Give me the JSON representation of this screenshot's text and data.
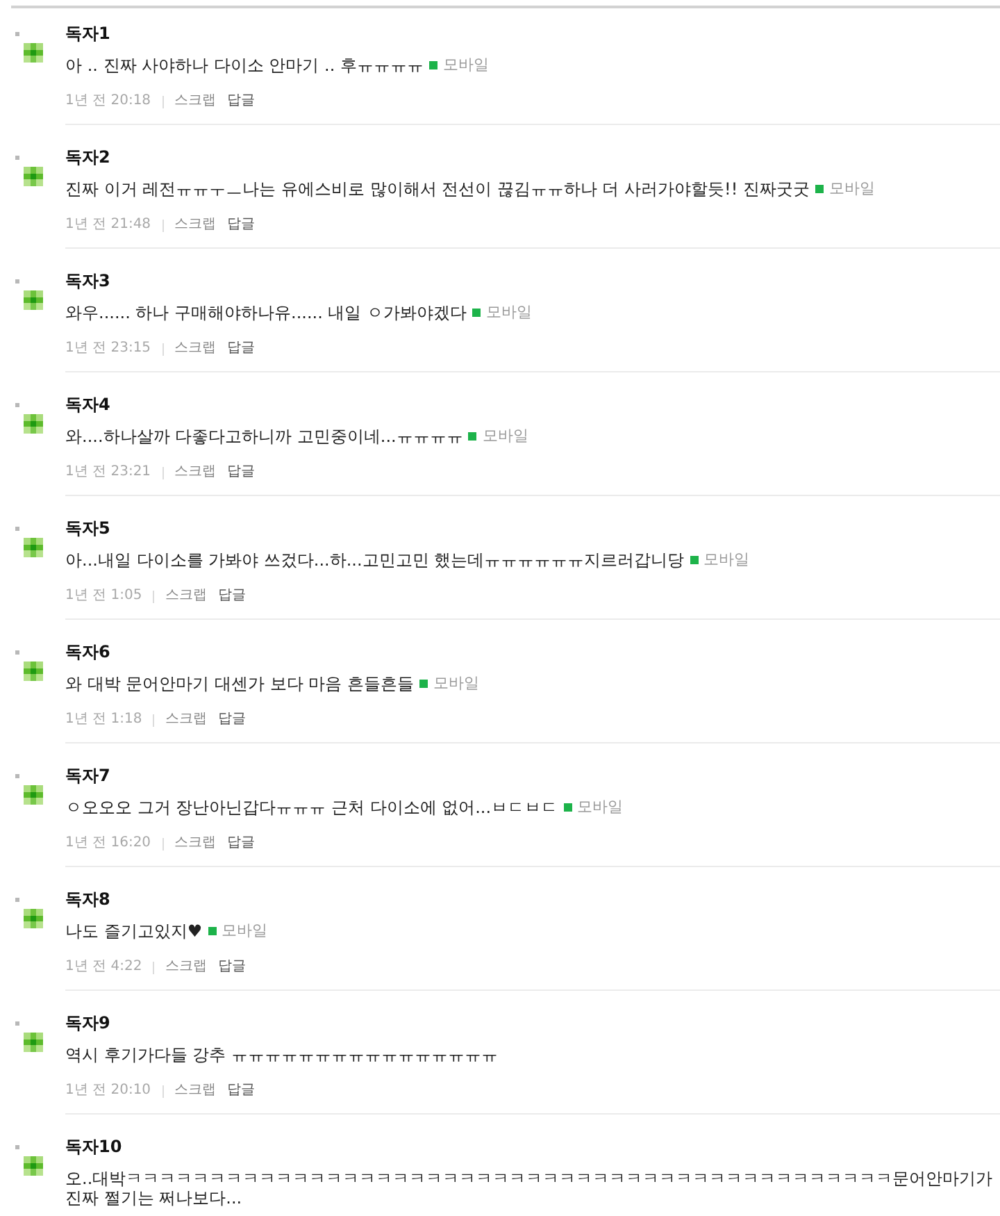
{
  "comments": [
    {
      "author": "독자1",
      "text": "아 .. 진짜 사야하나 다이소 안마기 .. 후ㅠㅠㅠㅠ",
      "mobile": "모바일",
      "time": "1년 전 20:18",
      "scrap": "스크랩",
      "reply": "답글"
    },
    {
      "author": "독자2",
      "text": "진짜 이거 레전ㅠㅠㅜㅡ나는 유에스비로 많이해서 전선이 끊김ㅠㅠ하나 더 사러가야할듯!! 진짜굿굿",
      "mobile": "모바일",
      "time": "1년 전 21:48",
      "scrap": "스크랩",
      "reply": "답글"
    },
    {
      "author": "독자3",
      "text": "와우...... 하나 구매해야하나유...... 내일 ㅇ가봐야겠다",
      "mobile": "모바일",
      "time": "1년 전 23:15",
      "scrap": "스크랩",
      "reply": "답글"
    },
    {
      "author": "독자4",
      "text": "와....하나살까 다좋다고하니까 고민중이네...ㅠㅠㅠㅠ",
      "mobile": "모바일",
      "time": "1년 전 23:21",
      "scrap": "스크랩",
      "reply": "답글"
    },
    {
      "author": "독자5",
      "text": "아...내일 다이소를 가봐야 쓰겄다...하...고민고민 했는데ㅠㅠㅠㅠㅠㅠ지르러갑니당",
      "mobile": "모바일",
      "time": "1년 전 1:05",
      "scrap": "스크랩",
      "reply": "답글"
    },
    {
      "author": "독자6",
      "text": "와 대박 문어안마기 대센가 보다 마음 흔들흔들",
      "mobile": "모바일",
      "time": "1년 전 1:18",
      "scrap": "스크랩",
      "reply": "답글"
    },
    {
      "author": "독자7",
      "text": "ㅇ오오오 그거 장난아닌갑다ㅠㅠㅠ 근처 다이소에 없어...ㅂㄷㅂㄷ",
      "mobile": "모바일",
      "time": "1년 전 16:20",
      "scrap": "스크랩",
      "reply": "답글"
    },
    {
      "author": "독자8",
      "text": "나도 즐기고있지♥",
      "mobile": "모바일",
      "time": "1년 전 4:22",
      "scrap": "스크랩",
      "reply": "답글"
    },
    {
      "author": "독자9",
      "text": "역시 후기가다들 강추 ㅠㅠㅠㅠㅠㅠㅠㅠㅠㅠㅠㅠㅠㅠㅠㅠ",
      "time": "1년 전 20:10",
      "scrap": "스크랩",
      "reply": "답글"
    },
    {
      "author": "독자10",
      "text": "오..대박ㅋㅋㅋㅋㅋㅋㅋㅋㅋㅋㅋㅋㅋㅋㅋㅋㅋㅋㅋㅋㅋㅋㅋㅋㅋㅋㅋㅋㅋㅋㅋㅋㅋㅋㅋㅋㅋㅋㅋㅋㅋㅋㅋㅋㅋㅋ문어안마기가 진짜 쩔기는 쩌나보다..."
    }
  ]
}
